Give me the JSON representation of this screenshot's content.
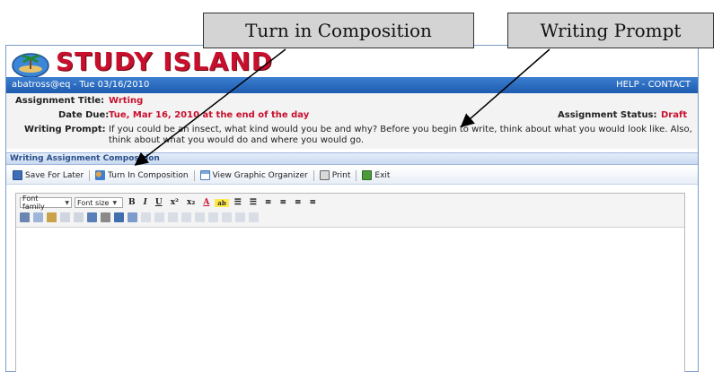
{
  "brand": "STUDY ISLAND",
  "topbar": {
    "user": "abatross@eq - Tue 03/16/2010",
    "help": "HELP",
    "sep": " - ",
    "contact": "CONTACT"
  },
  "assignment": {
    "title_label": "Assignment Title:",
    "title_value": "Wrting",
    "due_label": "Date Due:",
    "due_value": "Tue, Mar 16, 2010 at the end of the day",
    "status_label": "Assignment Status:",
    "status_value": "Draft",
    "prompt_label": "Writing Prompt:",
    "prompt_value": "If you could be an insect, what kind would you be and why? Before you begin to write, think about what you would look like. Also, think about what you would do and where you would go."
  },
  "section_title": "Writing Assignment Composition",
  "toolbar": {
    "save": "Save For Later",
    "turn_in": "Turn In Composition",
    "organizer": "View Graphic Organizer",
    "print": "Print",
    "exit": "Exit"
  },
  "editor": {
    "font_family": "Font family",
    "font_size": "Font size",
    "bold": "B",
    "italic": "I",
    "underline": "U"
  },
  "callouts": {
    "turn_in": "Turn in Composition",
    "prompt": "Writing Prompt"
  },
  "colors": {
    "brand_red": "#c8102e",
    "header_blue": "#1e5bb0"
  }
}
